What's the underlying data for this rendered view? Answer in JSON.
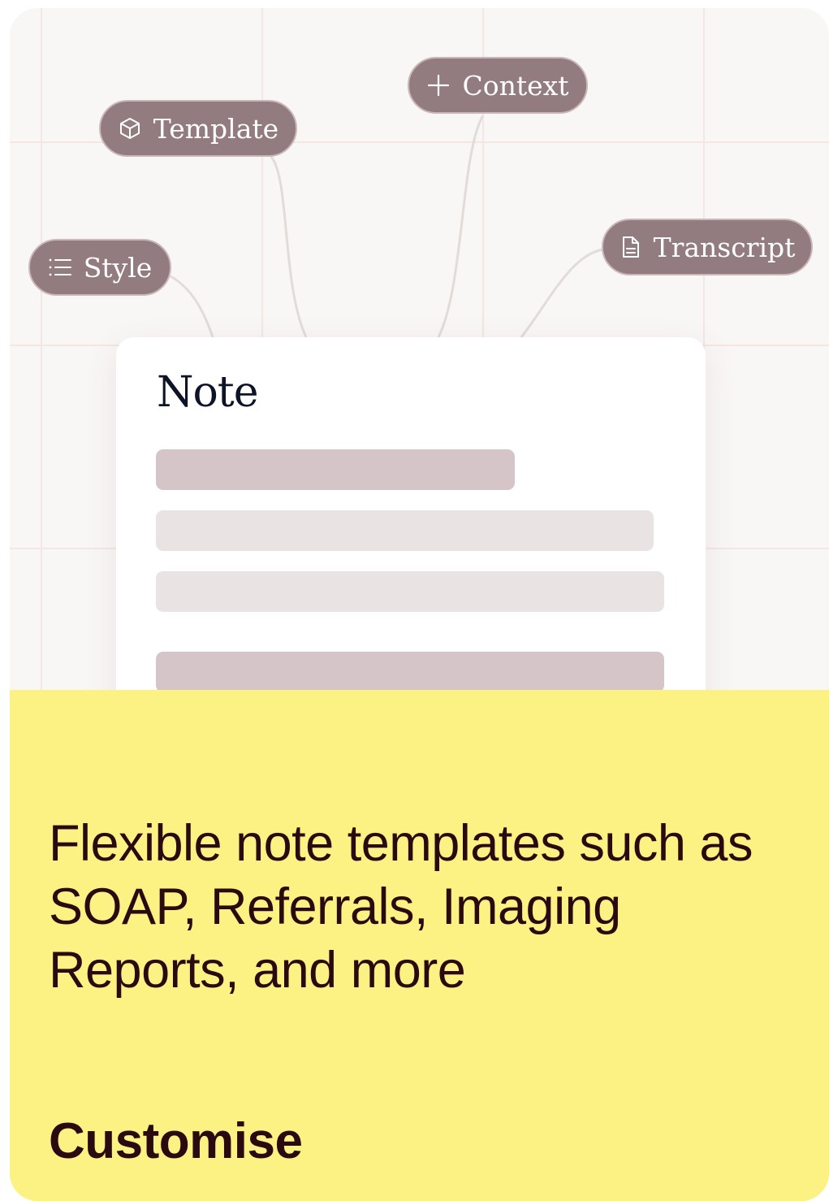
{
  "colors": {
    "pill_bg": "#927c7f",
    "panel_bg": "#fbf283",
    "bar_dark": "#d5c4c8",
    "bar_light": "#e9e3e3",
    "text_dark": "#2a0a10",
    "note_title": "#0e1428"
  },
  "pills": {
    "context": {
      "label": "Context",
      "icon": "sparkle-icon"
    },
    "template": {
      "label": "Template",
      "icon": "cube-icon"
    },
    "transcript": {
      "label": "Transcript",
      "icon": "document-icon"
    },
    "style": {
      "label": "Style",
      "icon": "list-icon"
    }
  },
  "note": {
    "title": "Note"
  },
  "panel": {
    "headline": "Flexible note templates such as SOAP, Referrals, Imaging Reports, and more",
    "cta": "Customise"
  }
}
